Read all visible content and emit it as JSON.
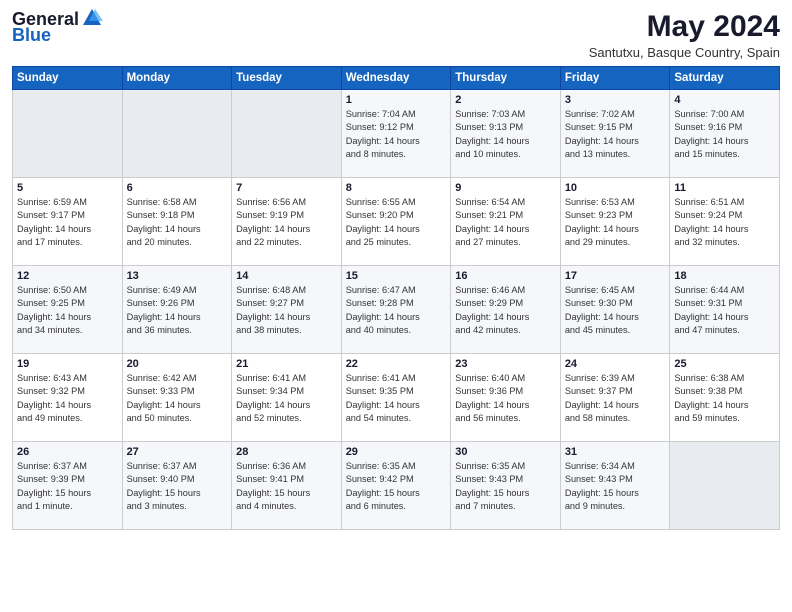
{
  "logo": {
    "general": "General",
    "blue": "Blue"
  },
  "header": {
    "month_year": "May 2024",
    "location": "Santutxu, Basque Country, Spain"
  },
  "days_of_week": [
    "Sunday",
    "Monday",
    "Tuesday",
    "Wednesday",
    "Thursday",
    "Friday",
    "Saturday"
  ],
  "weeks": [
    [
      {
        "day": "",
        "info": ""
      },
      {
        "day": "",
        "info": ""
      },
      {
        "day": "",
        "info": ""
      },
      {
        "day": "1",
        "info": "Sunrise: 7:04 AM\nSunset: 9:12 PM\nDaylight: 14 hours\nand 8 minutes."
      },
      {
        "day": "2",
        "info": "Sunrise: 7:03 AM\nSunset: 9:13 PM\nDaylight: 14 hours\nand 10 minutes."
      },
      {
        "day": "3",
        "info": "Sunrise: 7:02 AM\nSunset: 9:15 PM\nDaylight: 14 hours\nand 13 minutes."
      },
      {
        "day": "4",
        "info": "Sunrise: 7:00 AM\nSunset: 9:16 PM\nDaylight: 14 hours\nand 15 minutes."
      }
    ],
    [
      {
        "day": "5",
        "info": "Sunrise: 6:59 AM\nSunset: 9:17 PM\nDaylight: 14 hours\nand 17 minutes."
      },
      {
        "day": "6",
        "info": "Sunrise: 6:58 AM\nSunset: 9:18 PM\nDaylight: 14 hours\nand 20 minutes."
      },
      {
        "day": "7",
        "info": "Sunrise: 6:56 AM\nSunset: 9:19 PM\nDaylight: 14 hours\nand 22 minutes."
      },
      {
        "day": "8",
        "info": "Sunrise: 6:55 AM\nSunset: 9:20 PM\nDaylight: 14 hours\nand 25 minutes."
      },
      {
        "day": "9",
        "info": "Sunrise: 6:54 AM\nSunset: 9:21 PM\nDaylight: 14 hours\nand 27 minutes."
      },
      {
        "day": "10",
        "info": "Sunrise: 6:53 AM\nSunset: 9:23 PM\nDaylight: 14 hours\nand 29 minutes."
      },
      {
        "day": "11",
        "info": "Sunrise: 6:51 AM\nSunset: 9:24 PM\nDaylight: 14 hours\nand 32 minutes."
      }
    ],
    [
      {
        "day": "12",
        "info": "Sunrise: 6:50 AM\nSunset: 9:25 PM\nDaylight: 14 hours\nand 34 minutes."
      },
      {
        "day": "13",
        "info": "Sunrise: 6:49 AM\nSunset: 9:26 PM\nDaylight: 14 hours\nand 36 minutes."
      },
      {
        "day": "14",
        "info": "Sunrise: 6:48 AM\nSunset: 9:27 PM\nDaylight: 14 hours\nand 38 minutes."
      },
      {
        "day": "15",
        "info": "Sunrise: 6:47 AM\nSunset: 9:28 PM\nDaylight: 14 hours\nand 40 minutes."
      },
      {
        "day": "16",
        "info": "Sunrise: 6:46 AM\nSunset: 9:29 PM\nDaylight: 14 hours\nand 42 minutes."
      },
      {
        "day": "17",
        "info": "Sunrise: 6:45 AM\nSunset: 9:30 PM\nDaylight: 14 hours\nand 45 minutes."
      },
      {
        "day": "18",
        "info": "Sunrise: 6:44 AM\nSunset: 9:31 PM\nDaylight: 14 hours\nand 47 minutes."
      }
    ],
    [
      {
        "day": "19",
        "info": "Sunrise: 6:43 AM\nSunset: 9:32 PM\nDaylight: 14 hours\nand 49 minutes."
      },
      {
        "day": "20",
        "info": "Sunrise: 6:42 AM\nSunset: 9:33 PM\nDaylight: 14 hours\nand 50 minutes."
      },
      {
        "day": "21",
        "info": "Sunrise: 6:41 AM\nSunset: 9:34 PM\nDaylight: 14 hours\nand 52 minutes."
      },
      {
        "day": "22",
        "info": "Sunrise: 6:41 AM\nSunset: 9:35 PM\nDaylight: 14 hours\nand 54 minutes."
      },
      {
        "day": "23",
        "info": "Sunrise: 6:40 AM\nSunset: 9:36 PM\nDaylight: 14 hours\nand 56 minutes."
      },
      {
        "day": "24",
        "info": "Sunrise: 6:39 AM\nSunset: 9:37 PM\nDaylight: 14 hours\nand 58 minutes."
      },
      {
        "day": "25",
        "info": "Sunrise: 6:38 AM\nSunset: 9:38 PM\nDaylight: 14 hours\nand 59 minutes."
      }
    ],
    [
      {
        "day": "26",
        "info": "Sunrise: 6:37 AM\nSunset: 9:39 PM\nDaylight: 15 hours\nand 1 minute."
      },
      {
        "day": "27",
        "info": "Sunrise: 6:37 AM\nSunset: 9:40 PM\nDaylight: 15 hours\nand 3 minutes."
      },
      {
        "day": "28",
        "info": "Sunrise: 6:36 AM\nSunset: 9:41 PM\nDaylight: 15 hours\nand 4 minutes."
      },
      {
        "day": "29",
        "info": "Sunrise: 6:35 AM\nSunset: 9:42 PM\nDaylight: 15 hours\nand 6 minutes."
      },
      {
        "day": "30",
        "info": "Sunrise: 6:35 AM\nSunset: 9:43 PM\nDaylight: 15 hours\nand 7 minutes."
      },
      {
        "day": "31",
        "info": "Sunrise: 6:34 AM\nSunset: 9:43 PM\nDaylight: 15 hours\nand 9 minutes."
      },
      {
        "day": "",
        "info": ""
      }
    ]
  ]
}
